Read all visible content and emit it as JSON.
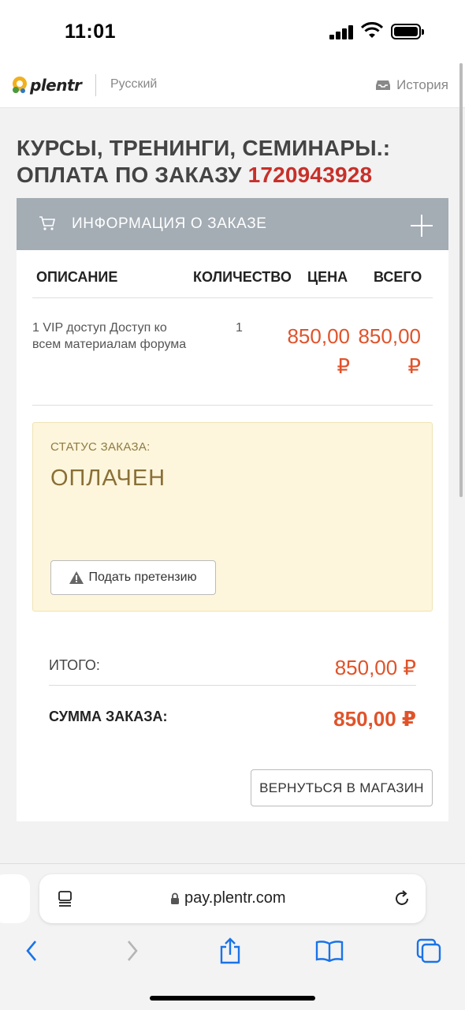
{
  "status_bar": {
    "time": "11:01"
  },
  "header": {
    "logo_text": "plentr",
    "language": "Русский",
    "history_label": "История"
  },
  "page": {
    "title_prefix": "КУРСЫ, ТРЕНИНГИ, СЕМИНАРЫ.: ОПЛАТА ПО ЗАКАЗУ",
    "order_number": "1720943928"
  },
  "order_panel": {
    "heading": "ИНФОРМАЦИЯ О ЗАКАЗЕ",
    "columns": [
      "ОПИСАНИЕ",
      "КОЛИЧЕСТВО",
      "ЦЕНА",
      "ВСЕГО"
    ],
    "items": [
      {
        "description": "1 VIP доступ Доступ ко всем материалам форума",
        "quantity": "1",
        "price": "850,00 ₽",
        "total": "850,00 ₽"
      }
    ],
    "status": {
      "label": "СТАТУС ЗАКАЗА:",
      "value": "ОПЛАЧЕН",
      "claim_button": "Подать претензию"
    },
    "summary": {
      "subtotal_label": "ИТОГО:",
      "subtotal_value": "850,00 ₽",
      "total_label": "СУММА ЗАКАЗА:",
      "total_value": "850,00 ₽"
    },
    "back_button": "ВЕРНУТЬСЯ В МАГАЗИН"
  },
  "browser": {
    "url": "pay.plentr.com"
  },
  "colors": {
    "accent_red": "#c8302a",
    "price_orange": "#e0532a",
    "panel_header": "#a4acb4",
    "status_bg": "#fdf6dc"
  }
}
